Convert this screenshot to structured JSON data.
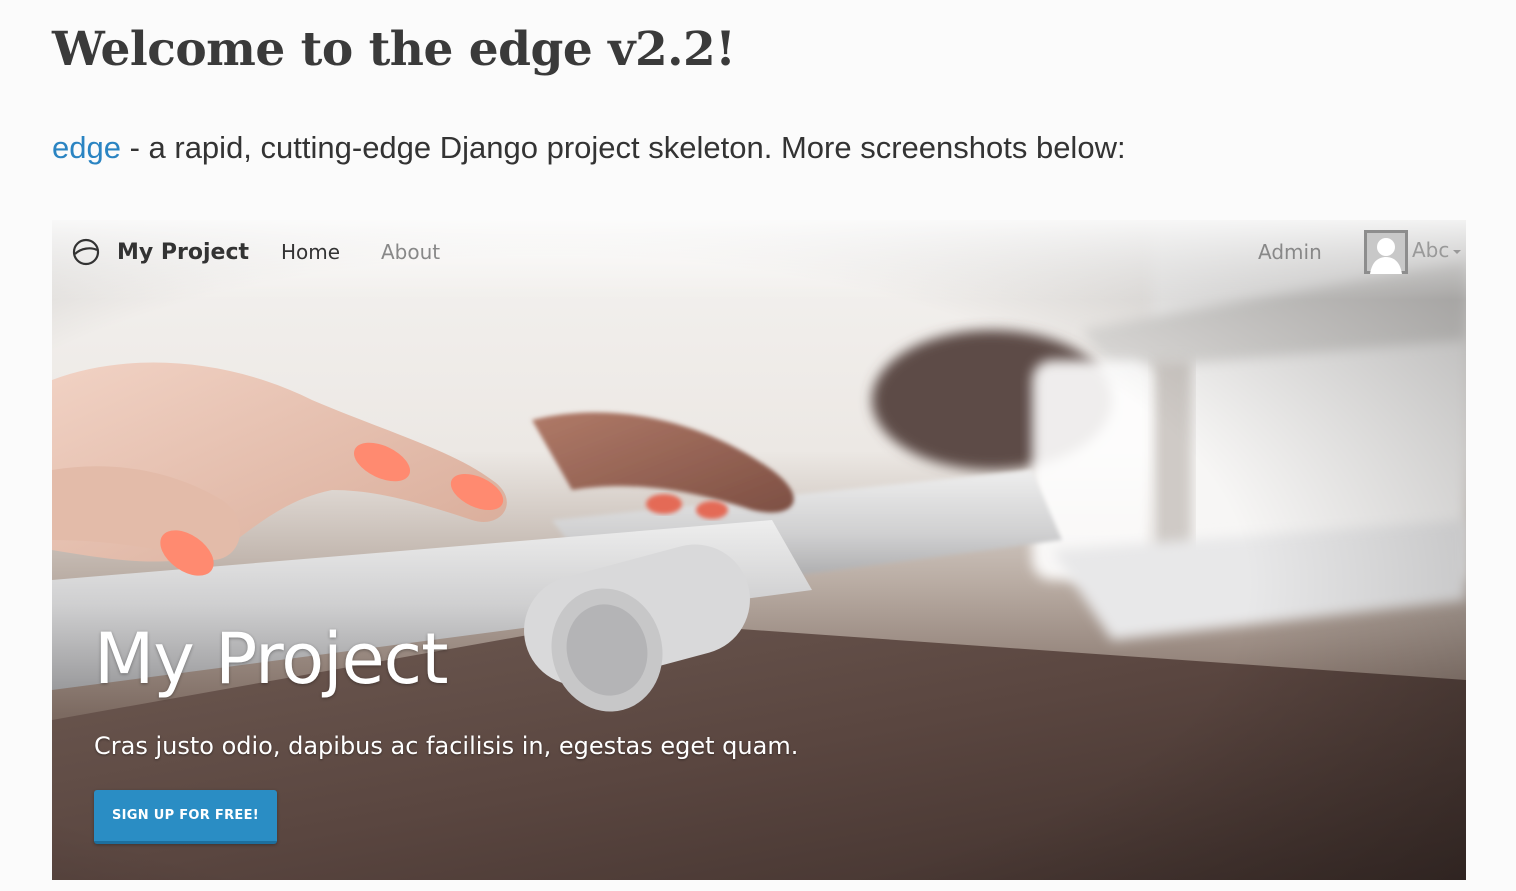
{
  "page": {
    "title": "Welcome to the edge v2.2!",
    "intro": {
      "link_text": "edge",
      "text": " - a rapid, cutting-edge Django project skeleton. More screenshots below:"
    }
  },
  "screenshot": {
    "navbar": {
      "brand": "My Project",
      "brand_icon": "logo-circle-icon",
      "links": [
        {
          "label": "Home",
          "active": true
        },
        {
          "label": "About",
          "active": false
        }
      ],
      "admin_label": "Admin",
      "user": {
        "name": "Abc",
        "avatar_icon": "user-avatar-icon",
        "dropdown_icon": "caret-down-icon"
      }
    },
    "hero": {
      "title": "My Project",
      "subtitle": "Cras justo odio, dapibus ac facilisis in, egestas eget quam.",
      "cta_label": "SIGN UP FOR FREE!"
    }
  },
  "colors": {
    "link": "#2a84c2",
    "cta_button": "#2a8dc4",
    "page_background": "#fbfbfb"
  }
}
